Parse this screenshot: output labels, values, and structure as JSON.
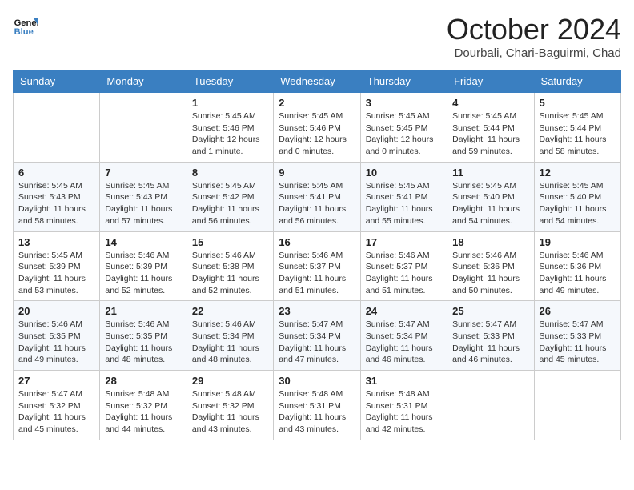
{
  "header": {
    "logo_line1": "General",
    "logo_line2": "Blue",
    "main_title": "October 2024",
    "subtitle": "Dourbali, Chari-Baguirmi, Chad"
  },
  "days_of_week": [
    "Sunday",
    "Monday",
    "Tuesday",
    "Wednesday",
    "Thursday",
    "Friday",
    "Saturday"
  ],
  "weeks": [
    [
      {
        "day": "",
        "info": ""
      },
      {
        "day": "",
        "info": ""
      },
      {
        "day": "1",
        "info": "Sunrise: 5:45 AM\nSunset: 5:46 PM\nDaylight: 12 hours\nand 1 minute."
      },
      {
        "day": "2",
        "info": "Sunrise: 5:45 AM\nSunset: 5:46 PM\nDaylight: 12 hours\nand 0 minutes."
      },
      {
        "day": "3",
        "info": "Sunrise: 5:45 AM\nSunset: 5:45 PM\nDaylight: 12 hours\nand 0 minutes."
      },
      {
        "day": "4",
        "info": "Sunrise: 5:45 AM\nSunset: 5:44 PM\nDaylight: 11 hours\nand 59 minutes."
      },
      {
        "day": "5",
        "info": "Sunrise: 5:45 AM\nSunset: 5:44 PM\nDaylight: 11 hours\nand 58 minutes."
      }
    ],
    [
      {
        "day": "6",
        "info": "Sunrise: 5:45 AM\nSunset: 5:43 PM\nDaylight: 11 hours\nand 58 minutes."
      },
      {
        "day": "7",
        "info": "Sunrise: 5:45 AM\nSunset: 5:43 PM\nDaylight: 11 hours\nand 57 minutes."
      },
      {
        "day": "8",
        "info": "Sunrise: 5:45 AM\nSunset: 5:42 PM\nDaylight: 11 hours\nand 56 minutes."
      },
      {
        "day": "9",
        "info": "Sunrise: 5:45 AM\nSunset: 5:41 PM\nDaylight: 11 hours\nand 56 minutes."
      },
      {
        "day": "10",
        "info": "Sunrise: 5:45 AM\nSunset: 5:41 PM\nDaylight: 11 hours\nand 55 minutes."
      },
      {
        "day": "11",
        "info": "Sunrise: 5:45 AM\nSunset: 5:40 PM\nDaylight: 11 hours\nand 54 minutes."
      },
      {
        "day": "12",
        "info": "Sunrise: 5:45 AM\nSunset: 5:40 PM\nDaylight: 11 hours\nand 54 minutes."
      }
    ],
    [
      {
        "day": "13",
        "info": "Sunrise: 5:45 AM\nSunset: 5:39 PM\nDaylight: 11 hours\nand 53 minutes."
      },
      {
        "day": "14",
        "info": "Sunrise: 5:46 AM\nSunset: 5:39 PM\nDaylight: 11 hours\nand 52 minutes."
      },
      {
        "day": "15",
        "info": "Sunrise: 5:46 AM\nSunset: 5:38 PM\nDaylight: 11 hours\nand 52 minutes."
      },
      {
        "day": "16",
        "info": "Sunrise: 5:46 AM\nSunset: 5:37 PM\nDaylight: 11 hours\nand 51 minutes."
      },
      {
        "day": "17",
        "info": "Sunrise: 5:46 AM\nSunset: 5:37 PM\nDaylight: 11 hours\nand 51 minutes."
      },
      {
        "day": "18",
        "info": "Sunrise: 5:46 AM\nSunset: 5:36 PM\nDaylight: 11 hours\nand 50 minutes."
      },
      {
        "day": "19",
        "info": "Sunrise: 5:46 AM\nSunset: 5:36 PM\nDaylight: 11 hours\nand 49 minutes."
      }
    ],
    [
      {
        "day": "20",
        "info": "Sunrise: 5:46 AM\nSunset: 5:35 PM\nDaylight: 11 hours\nand 49 minutes."
      },
      {
        "day": "21",
        "info": "Sunrise: 5:46 AM\nSunset: 5:35 PM\nDaylight: 11 hours\nand 48 minutes."
      },
      {
        "day": "22",
        "info": "Sunrise: 5:46 AM\nSunset: 5:34 PM\nDaylight: 11 hours\nand 48 minutes."
      },
      {
        "day": "23",
        "info": "Sunrise: 5:47 AM\nSunset: 5:34 PM\nDaylight: 11 hours\nand 47 minutes."
      },
      {
        "day": "24",
        "info": "Sunrise: 5:47 AM\nSunset: 5:34 PM\nDaylight: 11 hours\nand 46 minutes."
      },
      {
        "day": "25",
        "info": "Sunrise: 5:47 AM\nSunset: 5:33 PM\nDaylight: 11 hours\nand 46 minutes."
      },
      {
        "day": "26",
        "info": "Sunrise: 5:47 AM\nSunset: 5:33 PM\nDaylight: 11 hours\nand 45 minutes."
      }
    ],
    [
      {
        "day": "27",
        "info": "Sunrise: 5:47 AM\nSunset: 5:32 PM\nDaylight: 11 hours\nand 45 minutes."
      },
      {
        "day": "28",
        "info": "Sunrise: 5:48 AM\nSunset: 5:32 PM\nDaylight: 11 hours\nand 44 minutes."
      },
      {
        "day": "29",
        "info": "Sunrise: 5:48 AM\nSunset: 5:32 PM\nDaylight: 11 hours\nand 43 minutes."
      },
      {
        "day": "30",
        "info": "Sunrise: 5:48 AM\nSunset: 5:31 PM\nDaylight: 11 hours\nand 43 minutes."
      },
      {
        "day": "31",
        "info": "Sunrise: 5:48 AM\nSunset: 5:31 PM\nDaylight: 11 hours\nand 42 minutes."
      },
      {
        "day": "",
        "info": ""
      },
      {
        "day": "",
        "info": ""
      }
    ]
  ]
}
